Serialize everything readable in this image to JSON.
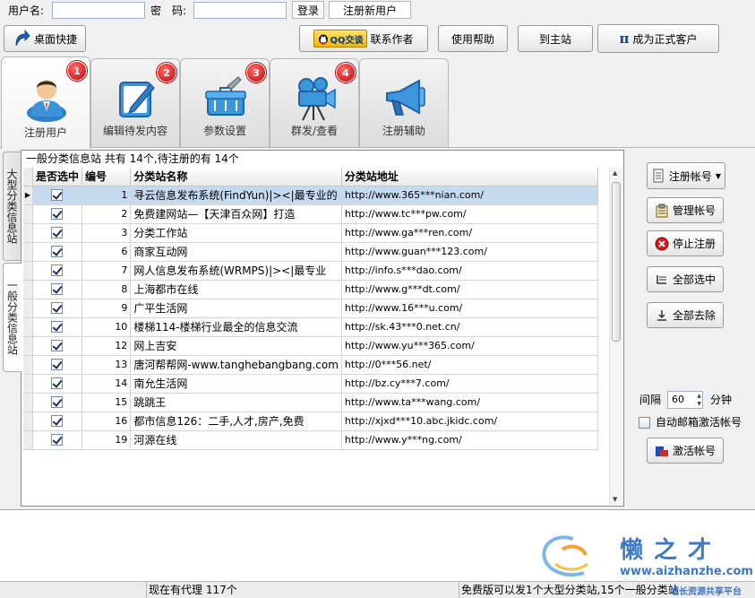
{
  "login": {
    "username_label": "用户名:",
    "username_value": "",
    "password_label": "密　码:",
    "password_value": "",
    "login_button": "登录",
    "register_button": "注册新用户"
  },
  "toolbar": {
    "desktop_shortcut": "桌面快捷",
    "qq_badge": "QQ交谈",
    "contact_author": "联系作者",
    "help": "使用帮助",
    "main_site": "到主站",
    "pi_symbol": "π",
    "become_customer": "成为正式客户"
  },
  "tabs": [
    {
      "label": "注册用户",
      "badge": "1",
      "icon": "user-icon"
    },
    {
      "label": "编辑待发内容",
      "badge": "2",
      "icon": "edit-note-icon"
    },
    {
      "label": "参数设置",
      "badge": "3",
      "icon": "toolbox-icon"
    },
    {
      "label": "群发/查看",
      "badge": "4",
      "icon": "camera-icon"
    },
    {
      "label": "注册辅助",
      "badge": "",
      "icon": "megaphone-icon"
    }
  ],
  "side_tabs": [
    {
      "label": "大型分类信息站"
    },
    {
      "label": "一般分类信息站"
    }
  ],
  "summary": "一般分类信息站 共有 14个,待注册的有 14个",
  "grid": {
    "columns": [
      "是否选中",
      "编号",
      "分类站名称",
      "分类站地址"
    ],
    "rows": [
      {
        "checked": true,
        "id": "1",
        "name": "寻云信息发布系统(FindYun)|><|最专业的",
        "url": "http://www.365***nian.com/"
      },
      {
        "checked": true,
        "id": "2",
        "name": "免费建网站—【天津百众网】打造",
        "url": "http://www.tc***pw.com/"
      },
      {
        "checked": true,
        "id": "3",
        "name": "分类工作站",
        "url": "http://www.ga***ren.com/"
      },
      {
        "checked": true,
        "id": "6",
        "name": "商家互动网",
        "url": "http://www.guan***123.com/"
      },
      {
        "checked": true,
        "id": "7",
        "name": "网人信息发布系统(WRMPS)|><|最专业",
        "url": "http://info.s***dao.com/"
      },
      {
        "checked": true,
        "id": "8",
        "name": "上海都市在线",
        "url": "http://www.g***dt.com/"
      },
      {
        "checked": true,
        "id": "9",
        "name": "广平生活网",
        "url": "http://www.16***u.com/"
      },
      {
        "checked": true,
        "id": "10",
        "name": "楼梯114-楼梯行业最全的信息交流",
        "url": "http://sk.43***0.net.cn/"
      },
      {
        "checked": true,
        "id": "12",
        "name": "网上吉安",
        "url": "http://www.yu***365.com/"
      },
      {
        "checked": true,
        "id": "13",
        "name": "唐河帮帮网-www.tanghebangbang.com",
        "url": "http://0***56.net/"
      },
      {
        "checked": true,
        "id": "14",
        "name": "南允生活网",
        "url": "http://bz.cy***7.com/"
      },
      {
        "checked": true,
        "id": "15",
        "name": "跳跳王",
        "url": "http://www.ta***wang.com/"
      },
      {
        "checked": true,
        "id": "16",
        "name": "都市信息126：二手,人才,房产,免费",
        "url": "http://xjxd***10.abc.jkidc.com/"
      },
      {
        "checked": true,
        "id": "19",
        "name": "河源在线",
        "url": "http://www.y***ng.com/"
      }
    ]
  },
  "side": {
    "register_account": "注册帐号",
    "manage_account": "管理帐号",
    "stop_register": "停止注册",
    "select_all": "全部选中",
    "deselect_all": "全部去除",
    "interval_label": "间隔",
    "interval_value": "60",
    "interval_unit": "分钟",
    "auto_activate_label": "自动邮箱激活帐号",
    "activate_account": "激活帐号"
  },
  "watermark": {
    "title": "懒之才",
    "url": "www.aizhanzhe.com",
    "tagline": "站长资源共享平台"
  },
  "status": {
    "proxy": "现在有代理 117个",
    "free_note": "免费版可以发1个大型分类站,15个一般分类站"
  },
  "colors": {
    "badge_red": "#d40000",
    "selected_row": "#c5d9ef"
  }
}
